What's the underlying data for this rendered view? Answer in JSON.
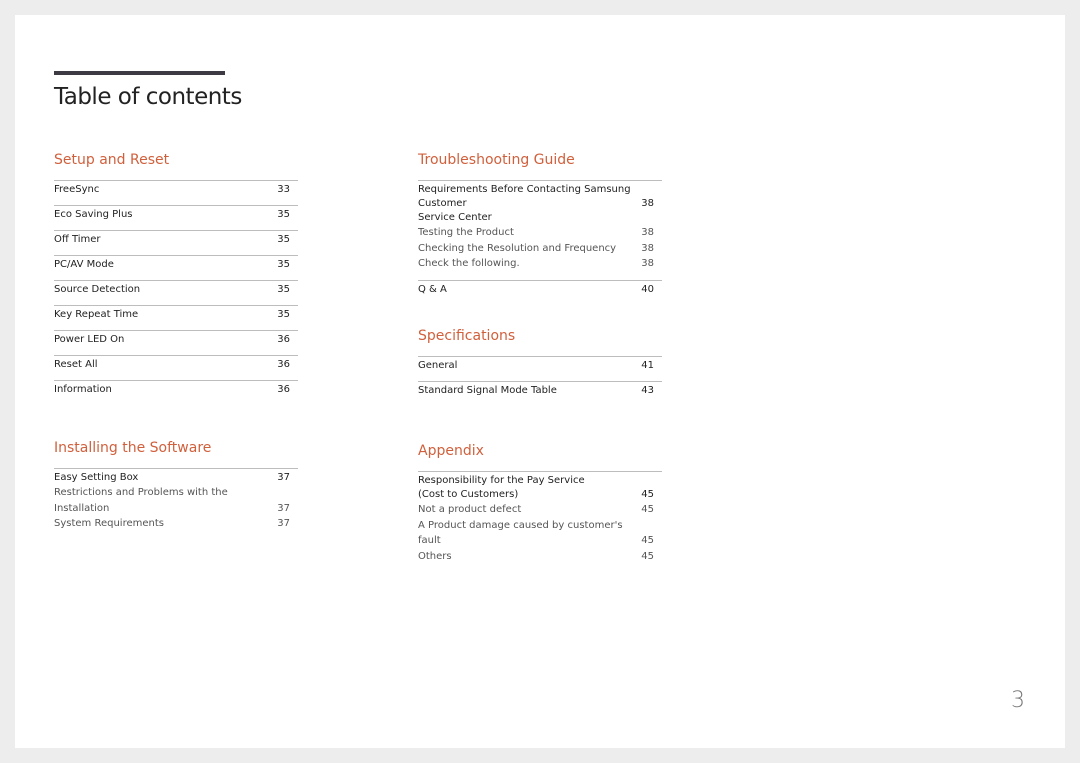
{
  "title": "Table of contents",
  "page_number": "3",
  "accent_color": "#d0603c",
  "sections": [
    {
      "heading": "Setup and Reset",
      "entries": [
        {
          "lines": [
            "FreeSync"
          ],
          "page": "33",
          "sub": false
        },
        {
          "lines": [
            "Eco Saving Plus"
          ],
          "page": "35",
          "sub": false
        },
        {
          "lines": [
            "Off Timer"
          ],
          "page": "35",
          "sub": false
        },
        {
          "lines": [
            "PC/AV Mode"
          ],
          "page": "35",
          "sub": false
        },
        {
          "lines": [
            "Source Detection"
          ],
          "page": "35",
          "sub": false
        },
        {
          "lines": [
            "Key Repeat Time"
          ],
          "page": "35",
          "sub": false
        },
        {
          "lines": [
            "Power LED On"
          ],
          "page": "36",
          "sub": false
        },
        {
          "lines": [
            "Reset All"
          ],
          "page": "36",
          "sub": false
        },
        {
          "lines": [
            "Information"
          ],
          "page": "36",
          "sub": false
        }
      ]
    },
    {
      "heading": "Installing the Software",
      "entries": [
        {
          "lines": [
            "Easy Setting Box"
          ],
          "page": "37",
          "sub": false
        },
        {
          "lines": [
            "Restrictions and Problems with the Installation"
          ],
          "page": "37",
          "sub": true
        },
        {
          "lines": [
            "System Requirements"
          ],
          "page": "37",
          "sub": true
        }
      ]
    },
    {
      "heading": "Troubleshooting Guide",
      "entries": [
        {
          "lines": [
            "Requirements Before Contacting Samsung Customer",
            "Service Center"
          ],
          "page": "38",
          "sub": false
        },
        {
          "lines": [
            "Testing the Product"
          ],
          "page": "38",
          "sub": true
        },
        {
          "lines": [
            "Checking the Resolution and Frequency"
          ],
          "page": "38",
          "sub": true
        },
        {
          "lines": [
            "Check the following."
          ],
          "page": "38",
          "sub": true
        },
        {
          "lines": [
            "Q & A"
          ],
          "page": "40",
          "sub": false
        }
      ]
    },
    {
      "heading": "Specifications",
      "entries": [
        {
          "lines": [
            "General"
          ],
          "page": "41",
          "sub": false
        },
        {
          "lines": [
            "Standard Signal Mode Table"
          ],
          "page": "43",
          "sub": false
        }
      ]
    },
    {
      "heading": "Appendix",
      "entries": [
        {
          "lines": [
            "Responsibility for the Pay Service",
            "(Cost to Customers)"
          ],
          "page": "45",
          "sub": false
        },
        {
          "lines": [
            "Not a product defect"
          ],
          "page": "45",
          "sub": true
        },
        {
          "lines": [
            "A Product damage caused by customer's fault"
          ],
          "page": "45",
          "sub": true
        },
        {
          "lines": [
            "Others"
          ],
          "page": "45",
          "sub": true
        }
      ]
    }
  ]
}
